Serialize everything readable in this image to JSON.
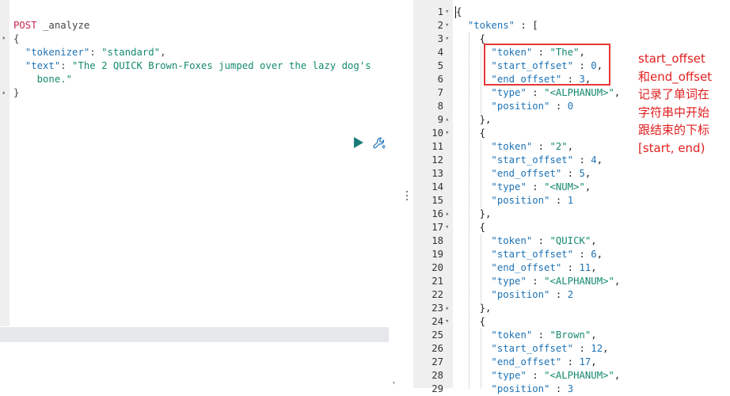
{
  "request": {
    "method": "POST",
    "endpoint": "_analyze",
    "lines": [
      {
        "parts": [
          [
            "kw",
            "POST"
          ],
          [
            "pl",
            " _analyze"
          ]
        ]
      },
      {
        "parts": [
          [
            "pl",
            "{"
          ]
        ]
      },
      {
        "parts": [
          [
            "pl",
            "  "
          ],
          [
            "key",
            "\"tokenizer\""
          ],
          [
            "pl",
            ": "
          ],
          [
            "str",
            "\"standard\""
          ],
          [
            "pl",
            ","
          ]
        ]
      },
      {
        "parts": [
          [
            "pl",
            "  "
          ],
          [
            "key",
            "\"text\""
          ],
          [
            "pl",
            ": "
          ],
          [
            "str",
            "\"The 2 QUICK Brown-Foxes jumped over the lazy dog's"
          ]
        ]
      },
      {
        "parts": [
          [
            "str",
            "    bone.\""
          ]
        ]
      },
      {
        "parts": [
          [
            "pl",
            "}"
          ]
        ]
      }
    ]
  },
  "response": {
    "line_numbers": [
      "1",
      "2",
      "3",
      "4",
      "5",
      "6",
      "7",
      "8",
      "9",
      "10",
      "11",
      "12",
      "13",
      "14",
      "15",
      "16",
      "17",
      "18",
      "19",
      "20",
      "21",
      "22",
      "23",
      "24",
      "25",
      "26",
      "27",
      "28",
      "29"
    ],
    "lines": [
      "{",
      "  \"tokens\" : [",
      "    {",
      "      \"token\" : \"The\",",
      "      \"start_offset\" : 0,",
      "      \"end_offset\" : 3,",
      "      \"type\" : \"<ALPHANUM>\",",
      "      \"position\" : 0",
      "    },",
      "    {",
      "      \"token\" : \"2\",",
      "      \"start_offset\" : 4,",
      "      \"end_offset\" : 5,",
      "      \"type\" : \"<NUM>\",",
      "      \"position\" : 1",
      "    },",
      "    {",
      "      \"token\" : \"QUICK\",",
      "      \"start_offset\" : 6,",
      "      \"end_offset\" : 11,",
      "      \"type\" : \"<ALPHANUM>\",",
      "      \"position\" : 2",
      "    },",
      "    {",
      "      \"token\" : \"Brown\",",
      "      \"start_offset\" : 12,",
      "      \"end_offset\" : 17,",
      "      \"type\" : \"<ALPHANUM>\",",
      "      \"position\" : 3"
    ]
  },
  "annotation": {
    "lines": [
      "start_offset",
      "和end_offset",
      "记录了单词在",
      "字符串中开始",
      "跟结束的下标",
      "[start, end)"
    ],
    "color": "#e02020"
  },
  "icons": {
    "run": "play-icon",
    "settings": "wrench-icon"
  }
}
